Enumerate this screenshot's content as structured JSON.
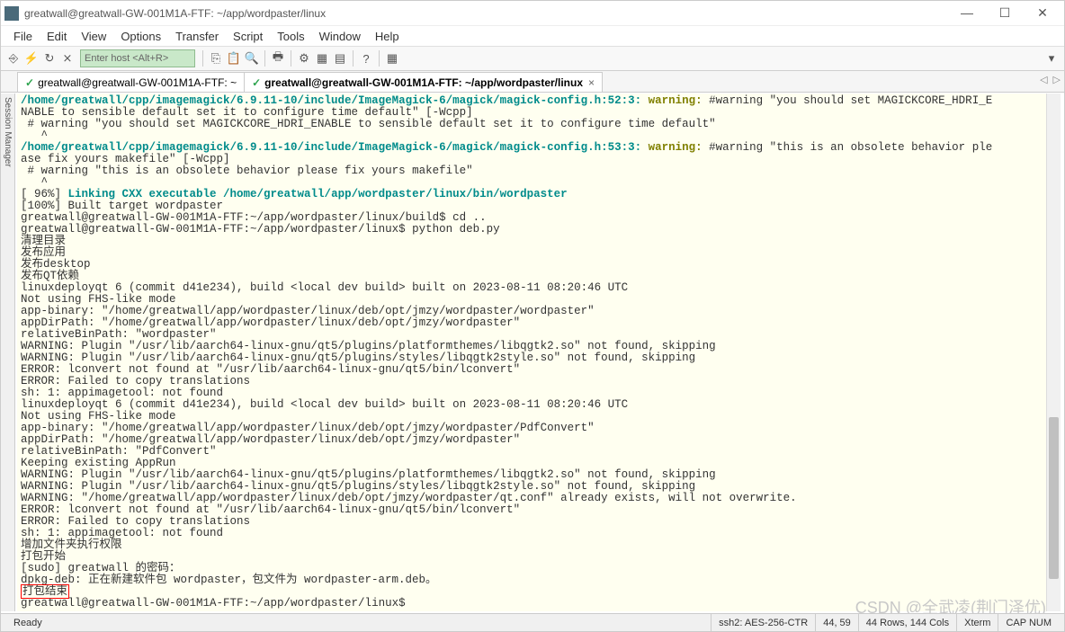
{
  "window": {
    "title": "greatwall@greatwall-GW-001M1A-FTF: ~/app/wordpaster/linux"
  },
  "menu": [
    "File",
    "Edit",
    "View",
    "Options",
    "Transfer",
    "Script",
    "Tools",
    "Window",
    "Help"
  ],
  "host_placeholder": "Enter host <Alt+R>",
  "tabs": [
    {
      "label": "greatwall@greatwall-GW-001M1A-FTF: ~",
      "active": false
    },
    {
      "label": "greatwall@greatwall-GW-001M1A-FTF: ~/app/wordpaster/linux",
      "active": true
    }
  ],
  "side_label": "Session Manager",
  "terminal": {
    "l1a": "/home/greatwall/cpp/imagemagick/6.9.11-10/include/ImageMagick-6/magick/magick-config.h:52:3:",
    "l1b": " warning: ",
    "l1c": "#warning \"you should set MAGICKCORE_HDRI_E",
    "l2": "NABLE to sensible default set it to configure time default\" [-Wcpp]",
    "l3": " # warning \"you should set MAGICKCORE_HDRI_ENABLE to sensible default set it to configure time default\"",
    "l4": "   ^",
    "l5a": "/home/greatwall/cpp/imagemagick/6.9.11-10/include/ImageMagick-6/magick/magick-config.h:53:3:",
    "l5b": " warning: ",
    "l5c": "#warning \"this is an obsolete behavior ple",
    "l6": "ase fix yours makefile\" [-Wcpp]",
    "l7": " # warning \"this is an obsolete behavior please fix yours makefile\"",
    "l8": "   ^",
    "l9": "[ 96%] ",
    "l9b": "Linking CXX executable /home/greatwall/app/wordpaster/linux/bin/wordpaster",
    "l10": "[100%] Built target wordpaster",
    "l11": "greatwall@greatwall-GW-001M1A-FTF:~/app/wordpaster/linux/build$ cd ..",
    "l12": "greatwall@greatwall-GW-001M1A-FTF:~/app/wordpaster/linux$ python deb.py",
    "l13": "清理目录",
    "l14": "发布应用",
    "l15": "发布desktop",
    "l16": "发布QT依赖",
    "l17": "linuxdeployqt 6 (commit d41e234), build <local dev build> built on 2023-08-11 08:20:46 UTC",
    "l18": "Not using FHS-like mode",
    "l19": "app-binary: \"/home/greatwall/app/wordpaster/linux/deb/opt/jmzy/wordpaster/wordpaster\"",
    "l20": "appDirPath: \"/home/greatwall/app/wordpaster/linux/deb/opt/jmzy/wordpaster\"",
    "l21": "relativeBinPath: \"wordpaster\"",
    "l22": "WARNING: Plugin \"/usr/lib/aarch64-linux-gnu/qt5/plugins/platformthemes/libqgtk2.so\" not found, skipping",
    "l23": "WARNING: Plugin \"/usr/lib/aarch64-linux-gnu/qt5/plugins/styles/libqgtk2style.so\" not found, skipping",
    "l24": "ERROR: lconvert not found at \"/usr/lib/aarch64-linux-gnu/qt5/bin/lconvert\"",
    "l25": "ERROR: Failed to copy translations",
    "l26": "sh: 1: appimagetool: not found",
    "l27": "linuxdeployqt 6 (commit d41e234), build <local dev build> built on 2023-08-11 08:20:46 UTC",
    "l28": "Not using FHS-like mode",
    "l29": "app-binary: \"/home/greatwall/app/wordpaster/linux/deb/opt/jmzy/wordpaster/PdfConvert\"",
    "l30": "appDirPath: \"/home/greatwall/app/wordpaster/linux/deb/opt/jmzy/wordpaster\"",
    "l31": "relativeBinPath: \"PdfConvert\"",
    "l32": "Keeping existing AppRun",
    "l33": "WARNING: Plugin \"/usr/lib/aarch64-linux-gnu/qt5/plugins/platformthemes/libqgtk2.so\" not found, skipping",
    "l34": "WARNING: Plugin \"/usr/lib/aarch64-linux-gnu/qt5/plugins/styles/libqgtk2style.so\" not found, skipping",
    "l35": "WARNING: \"/home/greatwall/app/wordpaster/linux/deb/opt/jmzy/wordpaster/qt.conf\" already exists, will not overwrite.",
    "l36": "ERROR: lconvert not found at \"/usr/lib/aarch64-linux-gnu/qt5/bin/lconvert\"",
    "l37": "ERROR: Failed to copy translations",
    "l38": "sh: 1: appimagetool: not found",
    "l39": "增加文件夹执行权限",
    "l40": "打包开始",
    "l41": "[sudo] greatwall 的密码：",
    "l42": "dpkg-deb: 正在新建软件包 wordpaster，包文件为 wordpaster-arm.deb。",
    "l43": "打包结束",
    "l44": "greatwall@greatwall-GW-001M1A-FTF:~/app/wordpaster/linux$ "
  },
  "status": {
    "ready": "Ready",
    "ssh": "ssh2: AES-256-CTR",
    "pos": "44,  59",
    "size": "44 Rows, 144 Cols",
    "term": "Xterm",
    "caps": "CAP  NUM"
  },
  "watermark": "CSDN @全武凌(荆门泽优)"
}
